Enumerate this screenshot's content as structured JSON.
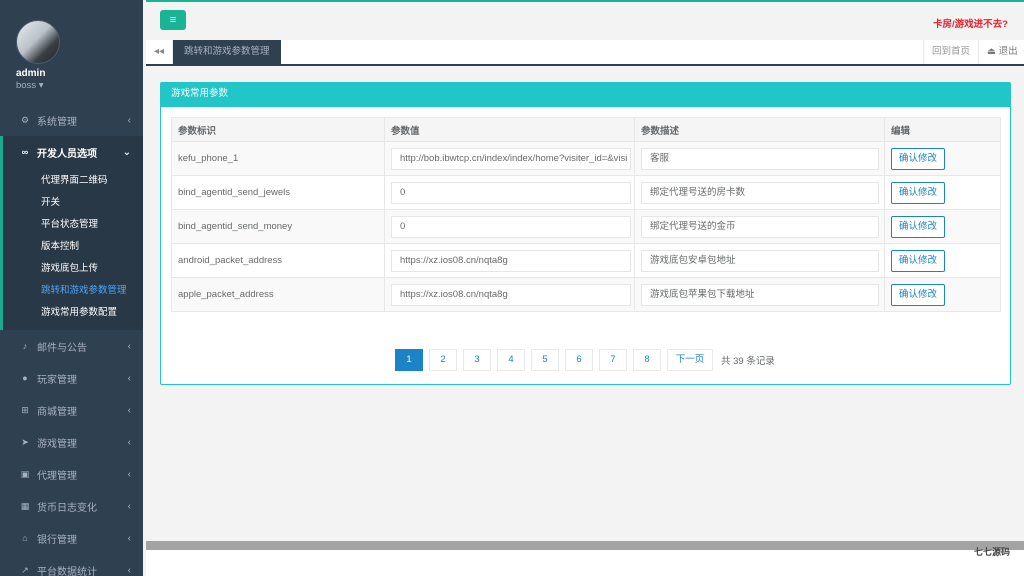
{
  "sidebar": {
    "user_name": "admin",
    "user_role": "boss ▾",
    "items": [
      {
        "label": "系统管理",
        "icon": "gears-icon",
        "glyph": "⚙"
      },
      {
        "label": "开发人员选项",
        "icon": "link-icon",
        "glyph": "∞"
      },
      {
        "label": "邮件与公告",
        "icon": "bell-icon",
        "glyph": "♪"
      },
      {
        "label": "玩家管理",
        "icon": "user-icon",
        "glyph": "●"
      },
      {
        "label": "商城管理",
        "icon": "cart-icon",
        "glyph": "⊞"
      },
      {
        "label": "游戏管理",
        "icon": "rocket-icon",
        "glyph": "➤"
      },
      {
        "label": "代理管理",
        "icon": "lock-icon",
        "glyph": "▣"
      },
      {
        "label": "货币日志变化",
        "icon": "calendar-icon",
        "glyph": "▦"
      },
      {
        "label": "银行管理",
        "icon": "bank-icon",
        "glyph": "⌂"
      },
      {
        "label": "平台数据统计",
        "icon": "chart-icon",
        "glyph": "↗"
      }
    ],
    "subitems": [
      "代理界面二维码",
      "开关",
      "平台状态管理",
      "版本控制",
      "游戏底包上传",
      "跳转和游戏参数管理",
      "游戏常用参数配置"
    ]
  },
  "topbar": {
    "menu_glyph": "≡",
    "right_link": "卡房/游戏进不去?"
  },
  "tabs": {
    "back_glyph": "◂◂",
    "active": "跳转和游戏参数管理",
    "home": "回到首页",
    "logout": "⏏ 退出"
  },
  "panel": {
    "title": "游戏常用参数",
    "columns": [
      "参数标识",
      "参数值",
      "参数描述",
      "编辑"
    ],
    "rows": [
      {
        "key": "kefu_phone_1",
        "value": "http://bob.ibwtcp.cn/index/index/home?visiter_id=&visi",
        "desc": "客服",
        "action": "确认修改"
      },
      {
        "key": "bind_agentid_send_jewels",
        "value": "0",
        "desc": "绑定代理号送的房卡数",
        "action": "确认修改"
      },
      {
        "key": "bind_agentid_send_money",
        "value": "0",
        "desc": "绑定代理号送的金币",
        "action": "确认修改"
      },
      {
        "key": "android_packet_address",
        "value": "https://xz.ios08.cn/nqta8g",
        "desc": "游戏底包安卓包地址",
        "action": "确认修改"
      },
      {
        "key": "apple_packet_address",
        "value": "https://xz.ios08.cn/nqta8g",
        "desc": "游戏底包苹果包下载地址",
        "action": "确认修改"
      }
    ]
  },
  "pagination": {
    "pages": [
      "1",
      "2",
      "3",
      "4",
      "5",
      "6",
      "7",
      "8"
    ],
    "current": "1",
    "next": "下一页",
    "total": "共 39 条记录"
  },
  "watermark": "七七源码",
  "colors": {
    "sidebar_bg": "#2f4050",
    "accent_green": "#1ab394",
    "panel_head": "#23c6c8",
    "link_blue": "#1c84c6",
    "alert_red": "#e4222a"
  }
}
